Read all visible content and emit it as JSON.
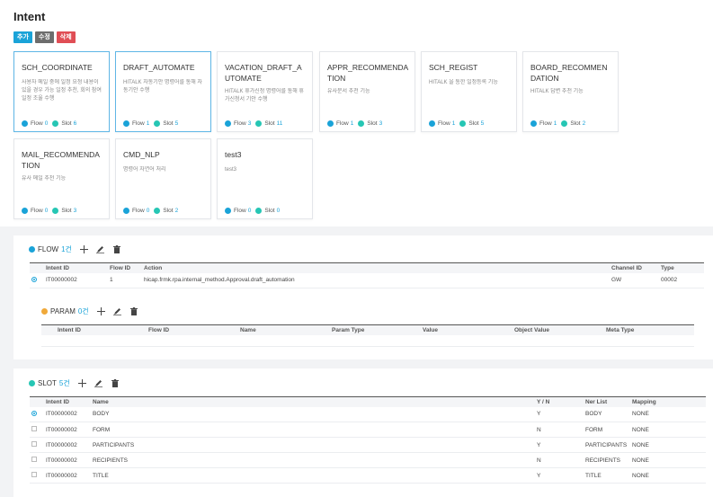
{
  "page": {
    "title": "Intent"
  },
  "actions": {
    "add": "추가",
    "edit": "수정",
    "delete": "삭제"
  },
  "footer_labels": {
    "flow": "Flow",
    "slot": "Slot"
  },
  "cards": [
    {
      "name": "SCH_COORDINATE",
      "desc": "사용자 메일 중에 일정 요청 내용이 있을 경우 가능 일정 추천, 회의 참여 일정 조율 수행",
      "flow": "0",
      "slot": "6"
    },
    {
      "name": "DRAFT_AUTOMATE",
      "desc": "HITALK 자동기안 명령어를 통해 자동기안 수행",
      "flow": "1",
      "slot": "5"
    },
    {
      "name": "VACATION_DRAFT_AUTOMATE",
      "desc": "HITALK 휴가신청 명령어를 통해 휴가신청서 기안 수행",
      "flow": "3",
      "slot": "11"
    },
    {
      "name": "APPR_RECOMMENDATION",
      "desc": "유사문서 추천 기능",
      "flow": "1",
      "slot": "3"
    },
    {
      "name": "SCH_REGIST",
      "desc": "HITALK 을 통한 일정등록 기능",
      "flow": "1",
      "slot": "5"
    },
    {
      "name": "BOARD_RECOMMENDATION",
      "desc": "HITALK 답변 추천 기능",
      "flow": "1",
      "slot": "2"
    },
    {
      "name": "MAIL_RECOMMENDATION",
      "desc": "유사 메일 추천 기능",
      "flow": "0",
      "slot": "3"
    },
    {
      "name": "CMD_NLP",
      "desc": "명령어 자연어 처리",
      "flow": "0",
      "slot": "2"
    },
    {
      "name": "test3",
      "desc": "test3",
      "flow": "0",
      "slot": "0"
    }
  ],
  "flow": {
    "title": "FLOW",
    "count": "1건",
    "headers": [
      "Intent ID",
      "Flow ID",
      "Action",
      "Channel ID",
      "Type"
    ],
    "rows": [
      {
        "intent_id": "IT00000002",
        "flow_id": "1",
        "action": "hicap.frmk.rpa.internal_method.Approval.draft_automation",
        "channel_id": "GW",
        "type": "00002"
      }
    ]
  },
  "param": {
    "title": "PARAM",
    "count": "0건",
    "headers": [
      "Intent ID",
      "Flow ID",
      "Name",
      "Param Type",
      "Value",
      "Object Value",
      "Meta Type"
    ]
  },
  "slot": {
    "title": "SLOT",
    "count": "5건",
    "headers": [
      "Intent ID",
      "Name",
      "Y / N",
      "Ner List",
      "Mapping"
    ],
    "rows": [
      {
        "intent_id": "IT00000002",
        "name": "BODY",
        "yn": "Y",
        "ner": "BODY",
        "mapping": "NONE"
      },
      {
        "intent_id": "IT00000002",
        "name": "FORM",
        "yn": "N",
        "ner": "FORM",
        "mapping": "NONE"
      },
      {
        "intent_id": "IT00000002",
        "name": "PARTICIPANTS",
        "yn": "Y",
        "ner": "PARTICIPANTS",
        "mapping": "NONE"
      },
      {
        "intent_id": "IT00000002",
        "name": "RECIPIENTS",
        "yn": "N",
        "ner": "RECIPIENTS",
        "mapping": "NONE"
      },
      {
        "intent_id": "IT00000002",
        "name": "TITLE",
        "yn": "Y",
        "ner": "TITLE",
        "mapping": "NONE"
      }
    ]
  }
}
